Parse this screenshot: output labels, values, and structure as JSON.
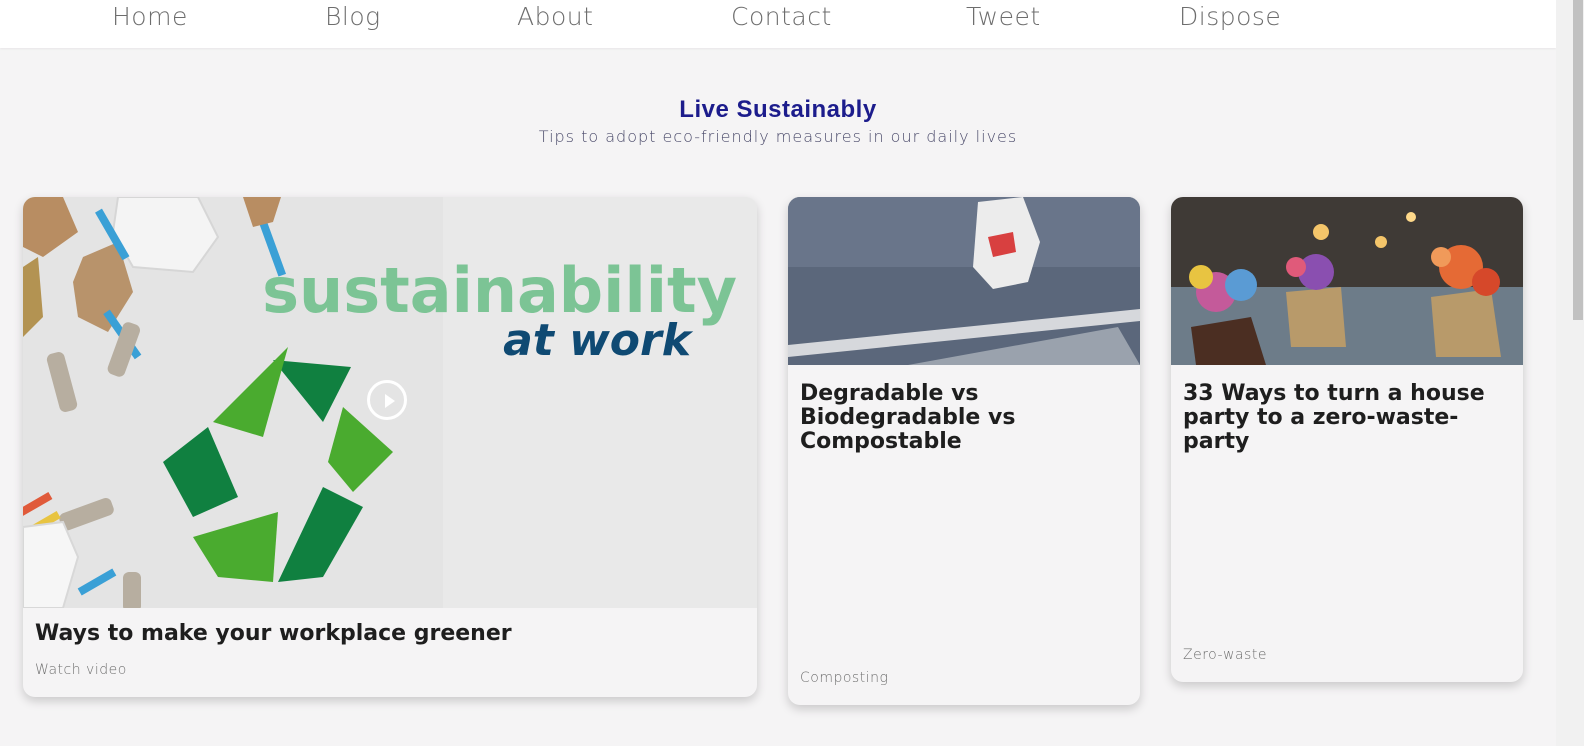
{
  "nav": {
    "items": [
      {
        "label": "Home"
      },
      {
        "label": "Blog"
      },
      {
        "label": "About"
      },
      {
        "label": "Contact"
      },
      {
        "label": "Tweet"
      },
      {
        "label": "Dispose"
      }
    ]
  },
  "section": {
    "title": "Live Sustainably",
    "subtitle": "Tips to adopt eco-friendly measures in our daily lives"
  },
  "cards": [
    {
      "title": "Ways to make your workplace greener",
      "tag": "Watch video",
      "image_text_top": "sustainability",
      "image_text_bottom": "at work"
    },
    {
      "title": "Degradable vs Biodegradable vs Compostable",
      "tag": "Composting"
    },
    {
      "title": "33 Ways to turn a house party to a zero-waste-party",
      "tag": "Zero-waste"
    }
  ],
  "colors": {
    "accent_title": "#1c1c8c",
    "image_green": "#7cc495",
    "image_navy": "#0f4a73",
    "background": "#f5f4f5"
  }
}
